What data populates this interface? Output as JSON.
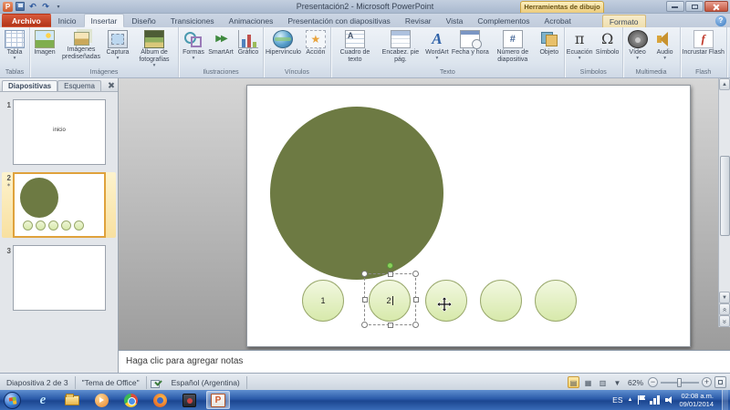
{
  "window": {
    "title": "Presentación2 - Microsoft PowerPoint",
    "contextual_header": "Herramientas de dibujo"
  },
  "tabs": {
    "file": "Archivo",
    "items": [
      "Inicio",
      "Insertar",
      "Diseño",
      "Transiciones",
      "Animaciones",
      "Presentación con diapositivas",
      "Revisar",
      "Vista",
      "Complementos",
      "Acrobat"
    ],
    "active": "Insertar",
    "contextual": "Formato"
  },
  "icons": {
    "help": "?",
    "ppt_letter": "P",
    "undo": "↶",
    "redo": "↷",
    "wordart_letter": "A",
    "equation_glyph": "π",
    "symbol_glyph": "Ω",
    "number_hash": "#",
    "flash_letter": "f",
    "action_star": "★",
    "cuadro_letter": "A",
    "ie_letter": "e",
    "taskbar_ppt_letter": "P"
  },
  "ribbon": {
    "groups": [
      {
        "label": "Tablas",
        "buttons": [
          {
            "label": "Tabla"
          }
        ]
      },
      {
        "label": "Imágenes",
        "buttons": [
          {
            "label": "Imagen"
          },
          {
            "label": "Imágenes prediseñadas"
          },
          {
            "label": "Captura"
          },
          {
            "label": "Álbum de fotografías"
          }
        ]
      },
      {
        "label": "Ilustraciones",
        "buttons": [
          {
            "label": "Formas"
          },
          {
            "label": "SmartArt"
          },
          {
            "label": "Gráfico"
          }
        ]
      },
      {
        "label": "Vínculos",
        "buttons": [
          {
            "label": "Hipervínculo"
          },
          {
            "label": "Acción"
          }
        ]
      },
      {
        "label": "Texto",
        "buttons": [
          {
            "label": "Cuadro de texto"
          },
          {
            "label": "Encabez. pie pág."
          },
          {
            "label": "WordArt"
          },
          {
            "label": "Fecha y hora"
          },
          {
            "label": "Número de diapositiva"
          },
          {
            "label": "Objeto"
          }
        ]
      },
      {
        "label": "Símbolos",
        "buttons": [
          {
            "label": "Ecuación"
          },
          {
            "label": "Símbolo"
          }
        ]
      },
      {
        "label": "Multimedia",
        "buttons": [
          {
            "label": "Vídeo"
          },
          {
            "label": "Audio"
          }
        ]
      },
      {
        "label": "Flash",
        "buttons": [
          {
            "label": "Incrustar Flash"
          }
        ]
      }
    ]
  },
  "slide_panel": {
    "tab_slides": "Diapositivas",
    "tab_outline": "Esquema",
    "slides": [
      {
        "number": "1",
        "text": "inicio"
      },
      {
        "number": "2",
        "text": ""
      },
      {
        "number": "3",
        "text": ""
      }
    ]
  },
  "canvas": {
    "circle_labels": [
      "1",
      "2",
      "",
      "",
      ""
    ]
  },
  "notes": {
    "placeholder": "Haga clic para agregar notas"
  },
  "status": {
    "slide_info": "Diapositiva 2 de 3",
    "theme": "\"Tema de Office\"",
    "language": "Español (Argentina)",
    "zoom_level": "62%"
  },
  "taskbar": {
    "language": "ES",
    "time": "02:08 a.m.",
    "date": "09/01/2014"
  },
  "colors": {
    "big_circle": "#6d7a43",
    "small_circle_fill": "#e3f0c2",
    "contextual_tab": "#f2d58e"
  }
}
